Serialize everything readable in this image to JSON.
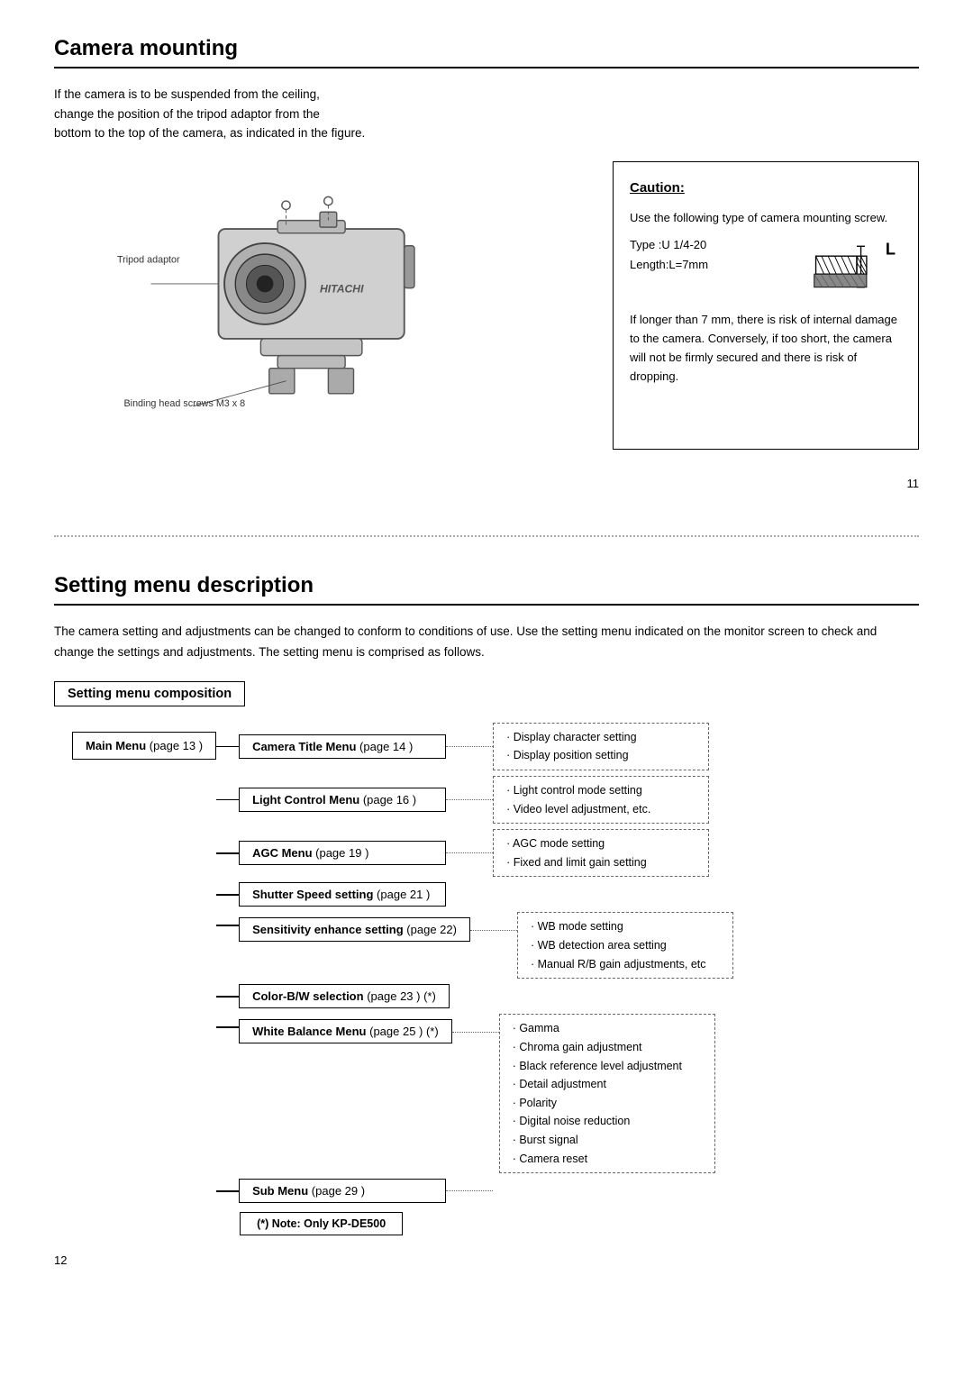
{
  "page1": {
    "title": "Camera mounting",
    "intro": "If the camera is to be suspended from the ceiling,\nchange the position of the tripod adaptor from the\nbottom to the top of the camera, as indicated in the figure.",
    "labels": {
      "tripod": "Tripod adaptor",
      "binding_screws": "Binding head screws M3 x 8"
    },
    "caution": {
      "heading": "Caution:",
      "line1": "Use the following type of camera mounting screw.",
      "type_label": "Type   :U 1/4-20",
      "length_label": "Length:L=7mm",
      "screw_letter": "L",
      "warning": "If longer than 7 mm, there is risk of internal damage to the camera. Conversely, if too short, the camera will not be firmly secured and there is risk of dropping."
    },
    "page_number": "11"
  },
  "page2": {
    "title": "Setting menu description",
    "intro": "The camera setting and adjustments can be changed to conform to conditions of use. Use the setting menu indicated on the monitor screen to check and change the settings and adjustments. The setting menu is comprised as follows.",
    "composition_title": "Setting menu composition",
    "main_menu_label": "Main Menu",
    "main_menu_page": "(page 13 )",
    "menu_items": [
      {
        "label": "Camera Title Menu",
        "page": "page 14 )",
        "bold": true,
        "has_dots": true,
        "sub": "· Display character setting\n· Display position setting"
      },
      {
        "label": "Light Control Menu",
        "page": "page 16 )",
        "bold": true,
        "has_dots": true,
        "sub": "· Light control mode setting\n· Video level adjustment, etc."
      },
      {
        "label": "AGC Menu",
        "page": "page 19 )",
        "bold": true,
        "has_dots": true,
        "sub": "· AGC mode setting\n· Fixed and limit gain setting"
      },
      {
        "label": "Shutter Speed setting",
        "page": "page 21 )",
        "bold": true,
        "has_dots": false,
        "sub": ""
      },
      {
        "label": "Sensitivity enhance setting",
        "page": "page 22)",
        "bold": true,
        "has_dots": false,
        "sub": "· WB mode setting\n· WB detection area setting\n· Manual R/B gain adjustments, etc"
      },
      {
        "label": "Color-B/W selection",
        "page": "page 23 )",
        "suffix": "(*)",
        "bold": true,
        "has_dots": false,
        "sub": ""
      },
      {
        "label": "White Balance Menu",
        "page": "page 25 )",
        "suffix": "(*)",
        "bold": true,
        "has_dots": true,
        "sub": "· Gamma\n· Chroma gain adjustment\n· Black reference level adjustment\n· Detail adjustment\n· Polarity\n· Digital noise reduction\n· Burst signal\n· Camera reset"
      },
      {
        "label": "Sub Menu",
        "page": "page 29 )",
        "bold": true,
        "has_dots": true,
        "sub": ""
      }
    ],
    "note_label": "(*) Note: Only KP-DE500",
    "page_number": "12"
  }
}
